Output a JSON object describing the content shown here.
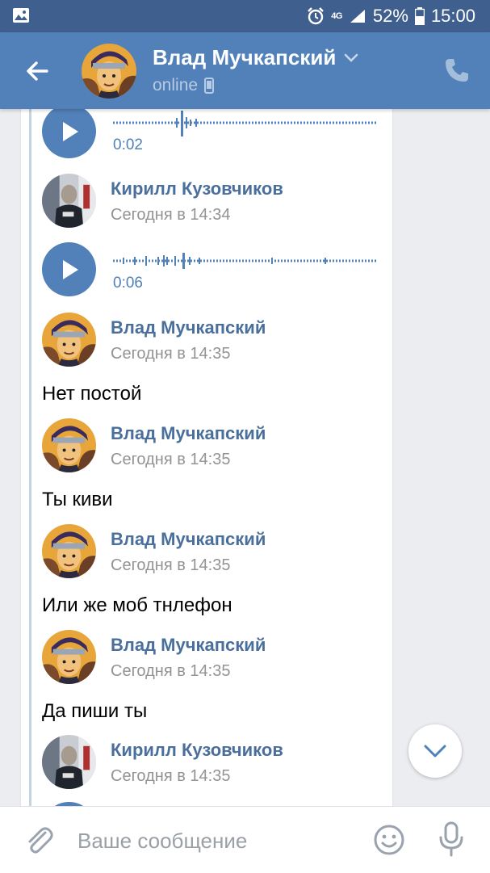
{
  "status_bar": {
    "network": "4G",
    "battery": "52%",
    "time": "15:00"
  },
  "header": {
    "contact_name": "Влад Мучкапский",
    "status": "online"
  },
  "chat": {
    "audio_top": {
      "duration": "0:02"
    },
    "sender_kirill_1": {
      "name": "Кирилл Кузовчиков",
      "time": "Сегодня в 14:34"
    },
    "audio_kirill": {
      "duration": "0:06"
    },
    "messages": [
      {
        "name": "Влад Мучкапский",
        "time": "Сегодня в 14:35",
        "text": "Нет постой"
      },
      {
        "name": "Влад Мучкапский",
        "time": "Сегодня в 14:35",
        "text": "Ты киви"
      },
      {
        "name": "Влад Мучкапский",
        "time": "Сегодня в 14:35",
        "text": "Или же моб тнлефон"
      },
      {
        "name": "Влад Мучкапский",
        "time": "Сегодня в 14:35",
        "text": "Да пиши ты"
      }
    ],
    "sender_kirill_2": {
      "name": "Кирилл Кузовчиков",
      "time": "Сегодня в 14:35"
    }
  },
  "composer": {
    "placeholder": "Ваше сообщение"
  },
  "colors": {
    "header": "#5181b8",
    "status_bar": "#3f5f8e",
    "accent": "#5181b8",
    "name_text": "#4a6f9c",
    "time_text": "#939393",
    "background": "#ebedf0"
  },
  "icons": {
    "back": "arrow-left-icon",
    "call": "phone-icon",
    "play": "play-icon",
    "attach": "paperclip-icon",
    "emoji": "smiley-icon",
    "mic": "microphone-icon",
    "scroll_down": "chevron-down-icon",
    "mobile": "mobile-phone-icon"
  }
}
